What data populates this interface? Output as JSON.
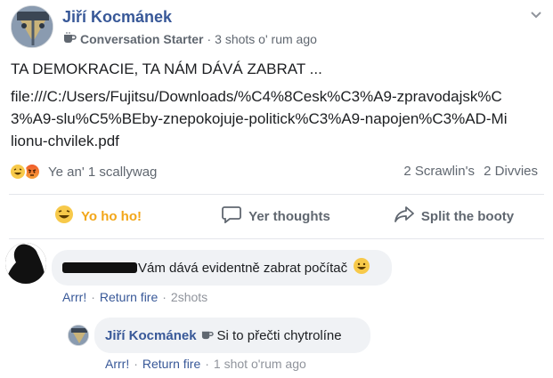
{
  "post": {
    "author": "Jiří Kocmánek",
    "badge": "Conversation Starter",
    "time": "3 shots o' rum ago",
    "title": "TA DEMOKRACIE, TA NÁM DÁVÁ ZABRAT ...",
    "link": "file:///C:/Users/Fujitsu/Downloads/%C4%8Cesk%C3%A9-zpravodajsk%C3%A9-slu%C5%BEby-znepokojuje-politick%C3%A9-napojen%C3%AD-Milionu-chvilek.pdf"
  },
  "reactions": {
    "summary": "Ye an' 1 scallywag",
    "comments_count": "2 Scrawlin's",
    "shares_count": "2 Divvies"
  },
  "actions": {
    "like": "Yo ho ho!",
    "comment": "Yer thoughts",
    "share": "Split the booty"
  },
  "comments": [
    {
      "text": "Vám dává evidentně zabrat počítač",
      "like": "Arrr!",
      "reply": "Return fire",
      "time": "2shots"
    },
    {
      "author": "Jiří Kocmánek",
      "text": "Si to přečti chytrolíne",
      "like": "Arrr!",
      "reply": "Return fire",
      "time": "1 shot o'rum ago"
    }
  ],
  "colors": {
    "link_blue": "#385898",
    "active_yellow": "#f2a619",
    "meta_gray": "#606770"
  }
}
